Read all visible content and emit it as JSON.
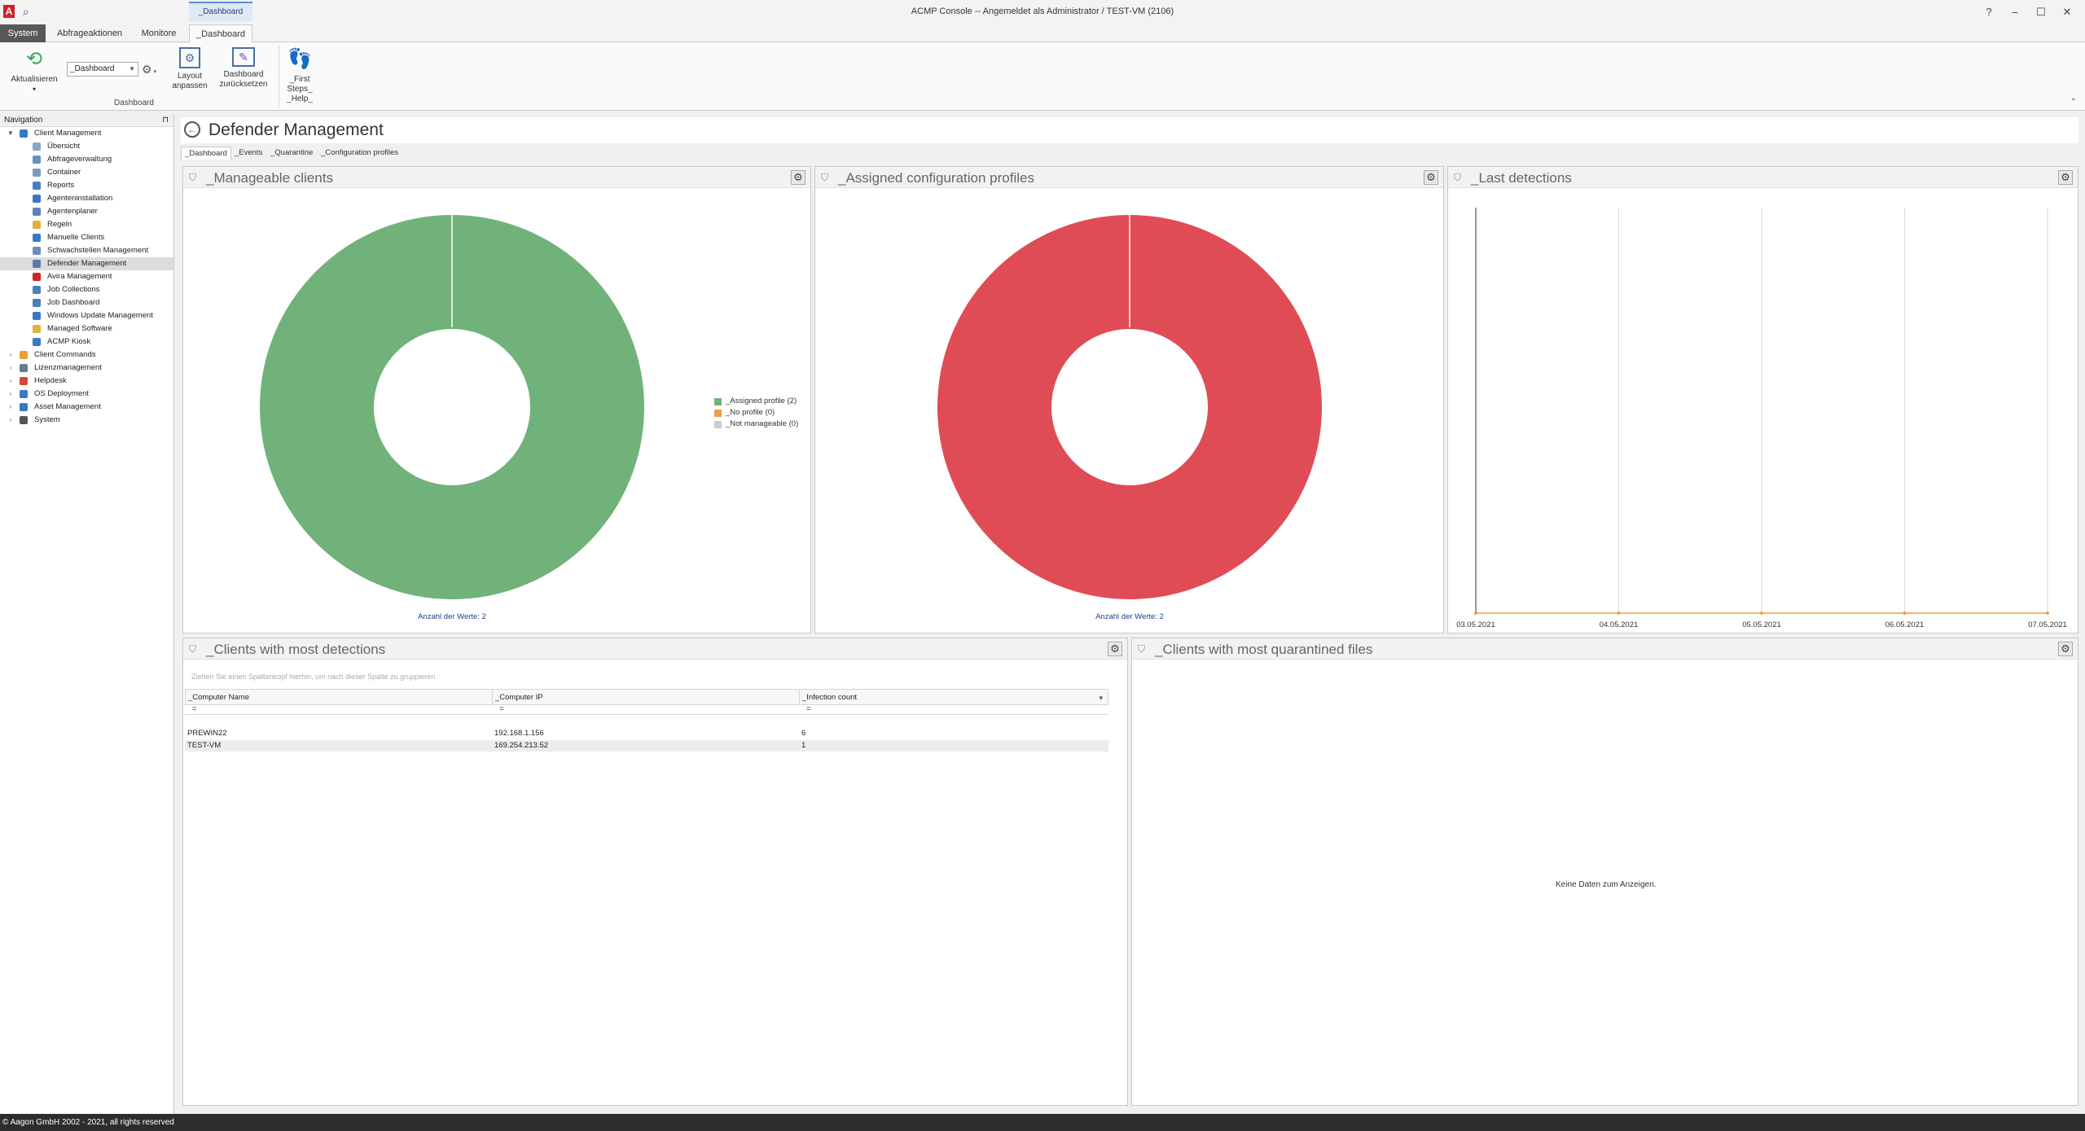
{
  "window": {
    "title": "ACMP Console -- Angemeldet als Administrator / TEST-VM (2106)",
    "context_group": "_Dashboard",
    "controls": {
      "help": "?",
      "minimize": "–",
      "maximize": "☐",
      "close": "✕"
    }
  },
  "ribbon": {
    "tabs": [
      {
        "label": "System"
      },
      {
        "label": "Abfrageaktionen"
      },
      {
        "label": "Monitore"
      },
      {
        "label": "_Dashboard"
      }
    ],
    "refresh_label": "Aktualisieren",
    "refresh_arrow": "▾",
    "dashboard_combo": "_Dashboard",
    "layout_label_1": "Layout",
    "layout_label_2": "anpassen",
    "reset_label_1": "Dashboard",
    "reset_label_2": "zurücksetzen",
    "first_steps_1": "_First",
    "first_steps_2": "Steps_",
    "first_steps_3": "_Help_",
    "group_label": "Dashboard"
  },
  "navigation": {
    "header": "Navigation",
    "items": [
      {
        "label": "Client Management",
        "level": 0,
        "expander": "▼",
        "color": "#3a78c6"
      },
      {
        "label": "Übersicht",
        "level": 1,
        "color": "#8aa4c8"
      },
      {
        "label": "Abfrageverwaltung",
        "level": 1,
        "color": "#6b8fbf"
      },
      {
        "label": "Container",
        "level": 1,
        "color": "#7a9cc2"
      },
      {
        "label": "Reports",
        "level": 1,
        "color": "#4a7fc0"
      },
      {
        "label": "Agenteninstallation",
        "level": 1,
        "color": "#3a78c6"
      },
      {
        "label": "Agentenplaner",
        "level": 1,
        "color": "#5d83b8"
      },
      {
        "label": "Regeln",
        "level": 1,
        "color": "#e0b040"
      },
      {
        "label": "Manuelle Clients",
        "level": 1,
        "color": "#3a78c6"
      },
      {
        "label": "Schwachstellen Management",
        "level": 1,
        "color": "#6b8fbf"
      },
      {
        "label": "Defender Management",
        "level": 1,
        "color": "#5a7aa8",
        "selected": true
      },
      {
        "label": "Avira Management",
        "level": 1,
        "color": "#d32027"
      },
      {
        "label": "Job Collections",
        "level": 1,
        "color": "#4a7fc0"
      },
      {
        "label": "Job Dashboard",
        "level": 1,
        "color": "#4a7fc0"
      },
      {
        "label": "Windows Update Management",
        "level": 1,
        "color": "#3a78c6"
      },
      {
        "label": "Managed Software",
        "level": 1,
        "color": "#e0b040"
      },
      {
        "label": "ACMP Kiosk",
        "level": 1,
        "color": "#3a78c6"
      },
      {
        "label": "Client Commands",
        "level": 0,
        "expander": "›",
        "color": "#e8a030"
      },
      {
        "label": "Lizenzmanagement",
        "level": 0,
        "expander": "›",
        "color": "#6b7a8c"
      },
      {
        "label": "Helpdesk",
        "level": 0,
        "expander": "›",
        "color": "#d9453a"
      },
      {
        "label": "OS Deployment",
        "level": 0,
        "expander": "›",
        "color": "#3a78c6"
      },
      {
        "label": "Asset Management",
        "level": 0,
        "expander": "›",
        "color": "#3a78c6"
      },
      {
        "label": "System",
        "level": 0,
        "expander": "›",
        "color": "#555555"
      }
    ]
  },
  "page": {
    "back_icon": "←",
    "title": "Defender Management",
    "subtabs": [
      {
        "label": "_Dashboard"
      },
      {
        "label": "_Events"
      },
      {
        "label": "_Quarantine"
      },
      {
        "label": "_Configuration profiles"
      }
    ]
  },
  "panels": {
    "manageable": {
      "title": "_Manageable clients",
      "caption": "Anzahl der Werte: 2",
      "legend": [
        {
          "label": "_Assigned profile (2)",
          "color": "#70b27a"
        },
        {
          "label": "_No profile (0)",
          "color": "#f0a040"
        },
        {
          "label": "_Not manageable (0)",
          "color": "#cccccc"
        }
      ],
      "slice_color": "#70b27a"
    },
    "assigned": {
      "title": "_Assigned configuration profiles",
      "caption": "Anzahl der Werte: 2",
      "slice_color": "#e04c55"
    },
    "last_detections": {
      "title": "_Last detections",
      "dates": [
        "03.05.2021",
        "04.05.2021",
        "05.05.2021",
        "06.05.2021",
        "07.05.2021"
      ]
    },
    "most_detections": {
      "title": "_Clients with most detections",
      "group_hint": "Ziehen Sie einen Spaltenkopf hierhin, um nach dieser Spalte zu gruppieren",
      "columns": [
        "_Computer Name",
        "_Computer IP",
        "_Infection count"
      ],
      "filter_mark": "=",
      "sort_indicator": "▾",
      "rows": [
        {
          "name": "PREWIN22",
          "ip": "192.168.1.156",
          "count": "6"
        },
        {
          "name": "TEST-VM",
          "ip": "169.254.213.52",
          "count": "1"
        }
      ]
    },
    "quarantined": {
      "title": "_Clients with most quarantined files",
      "empty": "Keine Daten zum Anzeigen."
    }
  },
  "statusbar": {
    "text": "© Aagon GmbH 2002 - 2021, all rights reserved"
  }
}
